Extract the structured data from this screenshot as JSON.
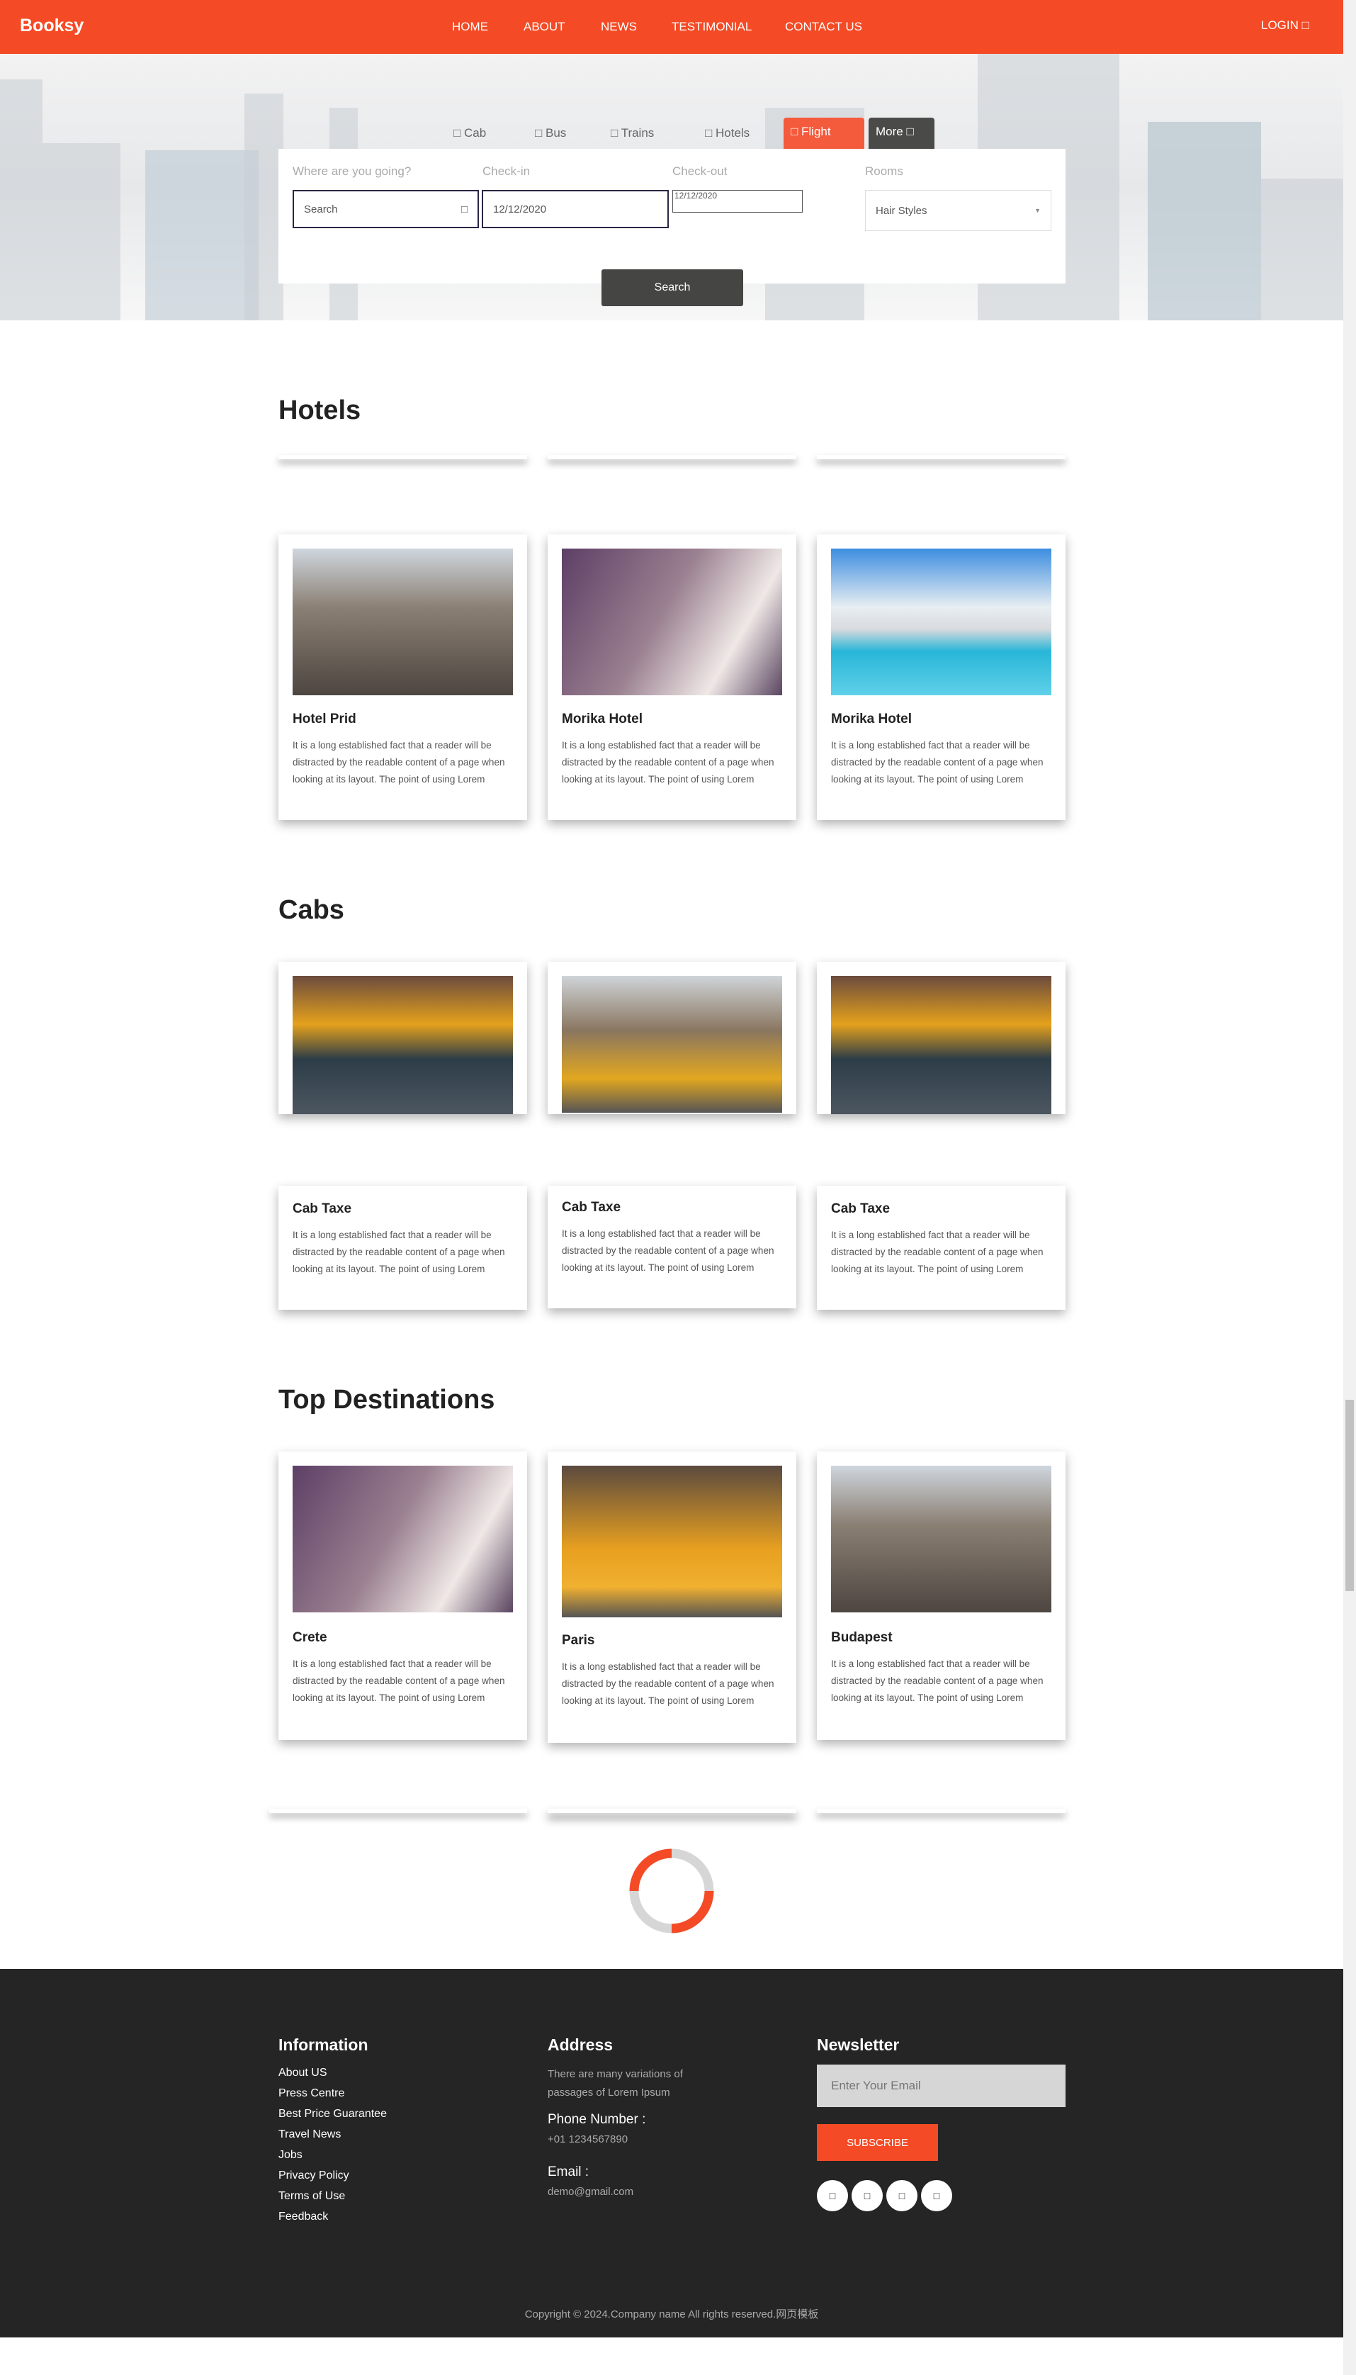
{
  "colors": {
    "accent": "#f44a25",
    "dark": "#252525",
    "button": "#454543"
  },
  "header": {
    "logo": "Booksy",
    "nav": [
      "HOME",
      "ABOUT",
      "NEWS",
      "TESTIMONIAL",
      "CONTACT US"
    ],
    "login": "LOGIN",
    "login_icon": "user-icon"
  },
  "search": {
    "tabs": [
      {
        "icon": "car-icon",
        "label": "Cab"
      },
      {
        "icon": "bus-icon",
        "label": "Bus"
      },
      {
        "icon": "train-icon",
        "label": "Trains"
      },
      {
        "icon": "hotel-icon",
        "label": "Hotels"
      },
      {
        "icon": "plane-icon",
        "label": "Flight"
      },
      {
        "label": "More",
        "icon": "chevron-down-icon"
      }
    ],
    "where_label": "Where are you going?",
    "where_placeholder": "Search",
    "checkin_label": "Check-in",
    "checkin_value": "12/12/2020",
    "checkout_label": "Check-out",
    "checkout_value": "12/12/2020",
    "rooms_label": "Rooms",
    "rooms_value": "Hair Styles",
    "button": "Search"
  },
  "hotels": {
    "title": "Hotels",
    "items": [
      {
        "name": "Hotel Prid",
        "text": "It is a long established fact that a reader will be distracted by the readable content of a page when looking at its layout. The point of using Lorem"
      },
      {
        "name": "Morika Hotel",
        "text": "It is a long established fact that a reader will be distracted by the readable content of a page when looking at its layout. The point of using Lorem"
      },
      {
        "name": "Morika Hotel",
        "text": "It is a long established fact that a reader will be distracted by the readable content of a page when looking at its layout. The point of using Lorem"
      }
    ]
  },
  "cabs": {
    "title": "Cabs",
    "items": [
      {
        "name": "Cab Taxe",
        "text": "It is a long established fact that a reader will be distracted by the readable content of a page when looking at its layout. The point of using Lorem"
      },
      {
        "name": "Cab Taxe",
        "text": "It is a long established fact that a reader will be distracted by the readable content of a page when looking at its layout. The point of using Lorem"
      },
      {
        "name": "Cab Taxe",
        "text": "It is a long established fact that a reader will be distracted by the readable content of a page when looking at its layout. The point of using Lorem"
      }
    ]
  },
  "destinations": {
    "title": "Top Destinations",
    "items": [
      {
        "name": "Crete",
        "text": "It is a long established fact that a reader will be distracted by the readable content of a page when looking at its layout. The point of using Lorem"
      },
      {
        "name": "Paris",
        "text": "It is a long established fact that a reader will be distracted by the readable content of a page when looking at its layout. The point of using Lorem"
      },
      {
        "name": "Budapest",
        "text": "It is a long established fact that a reader will be distracted by the readable content of a page when looking at its layout. The point of using Lorem"
      }
    ]
  },
  "footer": {
    "info_title": "Information",
    "links": [
      "About US",
      "Press Centre",
      "Best Price Guarantee",
      "Travel News",
      "Jobs",
      "Privacy Policy",
      "Terms of Use",
      "Feedback"
    ],
    "address_title": "Address",
    "address_text": "There are many variations of passages of Lorem Ipsum",
    "phone_label": "Phone Number :",
    "phone": "+01 1234567890",
    "email_label": "Email :",
    "email": "demo@gmail.com",
    "newsletter_title": "Newsletter",
    "email_placeholder": "Enter Your Email",
    "subscribe": "SUBSCRIBE",
    "social": [
      "facebook-icon",
      "twitter-icon",
      "linkedin-icon",
      "instagram-icon"
    ],
    "copyright": "Copyright © 2024.Company name All rights reserved.网页模板"
  }
}
